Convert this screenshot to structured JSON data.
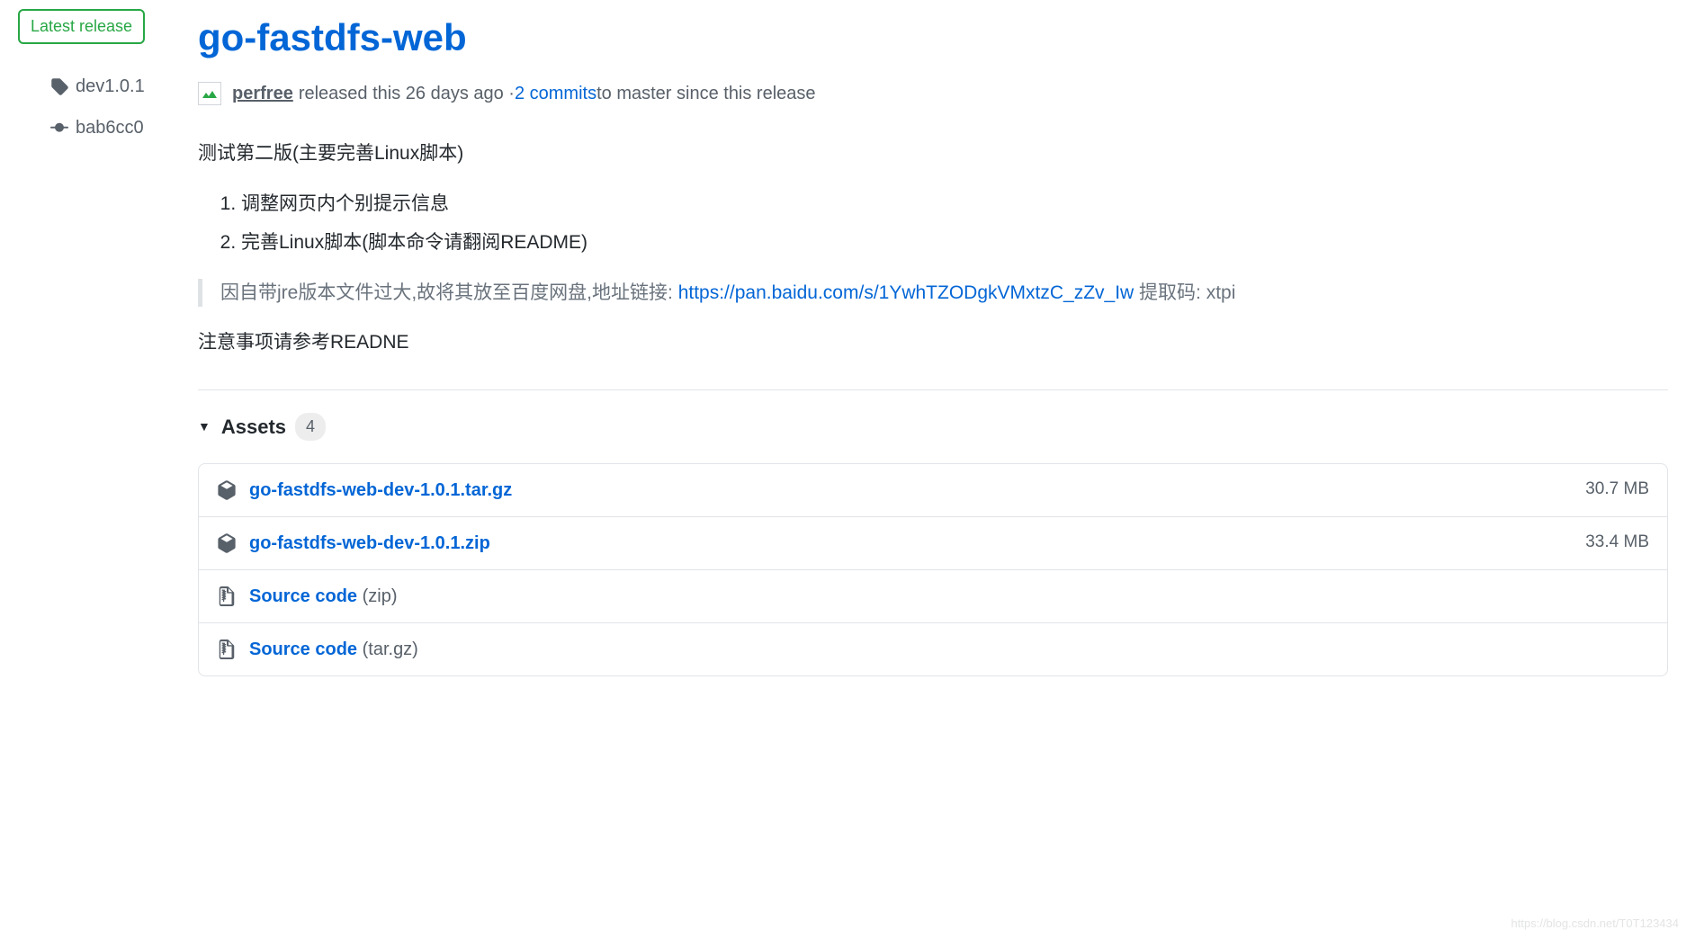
{
  "sidebar": {
    "latest_label": "Latest release",
    "tag_name": "dev1.0.1",
    "commit_sha": "bab6cc0"
  },
  "release": {
    "title": "go-fastdfs-web",
    "author": "perfree",
    "released_text": " released this 26 days ago · ",
    "commits_link": "2 commits",
    "to_master_text": " to master since this release"
  },
  "body": {
    "intro": "测试第二版(主要完善Linux脚本)",
    "items": [
      "调整网页内个别提示信息",
      "完善Linux脚本(脚本命令请翻阅README)"
    ],
    "blockquote_prefix": "因自带jre版本文件过大,故将其放至百度网盘,地址链接: ",
    "blockquote_link": "https://pan.baidu.com/s/1YwhTZODgkVMxtzC_zZv_Iw",
    "blockquote_suffix": " 提取码: xtpi",
    "footer": "注意事项请参考READNE"
  },
  "assets": {
    "label": "Assets",
    "count": "4",
    "items": [
      {
        "name": "go-fastdfs-web-dev-1.0.1.tar.gz",
        "ext": "",
        "size": "30.7 MB",
        "icon": "package"
      },
      {
        "name": "go-fastdfs-web-dev-1.0.1.zip",
        "ext": "",
        "size": "33.4 MB",
        "icon": "package"
      },
      {
        "name": "Source code",
        "ext": "(zip)",
        "size": "",
        "icon": "zip"
      },
      {
        "name": "Source code",
        "ext": "(tar.gz)",
        "size": "",
        "icon": "zip"
      }
    ]
  },
  "watermark": "https://blog.csdn.net/T0T123434"
}
